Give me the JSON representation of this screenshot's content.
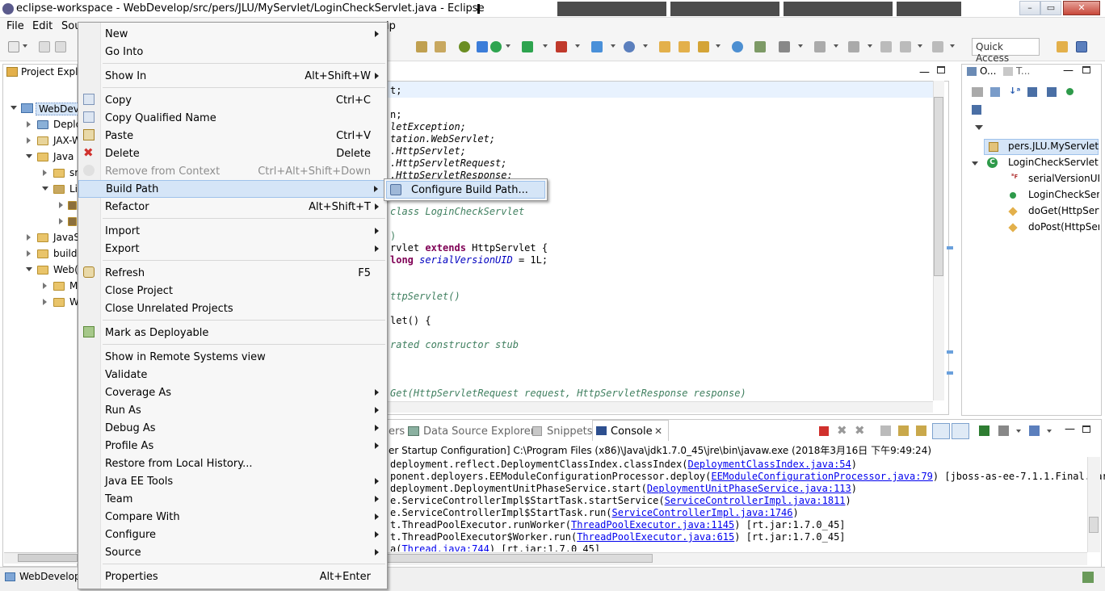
{
  "window": {
    "title": "eclipse-workspace - WebDevelop/src/pers/JLU/MyServlet/LoginCheckServlet.java - Eclipse",
    "minimize": "–",
    "maximize": "▭",
    "close": "✕"
  },
  "menubar": {
    "items": [
      "File",
      "Edit",
      "Sou",
      "lp"
    ]
  },
  "toolbar": {
    "quick_access": "Quick Access"
  },
  "project_explorer": {
    "tab_label": "Project Expl",
    "items": [
      {
        "label": "WebDevel"
      },
      {
        "label": "Deplo"
      },
      {
        "label": "JAX-W"
      },
      {
        "label": "Java"
      },
      {
        "label": "sr"
      },
      {
        "label": "Li"
      },
      {
        "label": "JavaS"
      },
      {
        "label": "build"
      },
      {
        "label": "Web("
      },
      {
        "label": "M"
      },
      {
        "label": "W"
      }
    ]
  },
  "context_menu": {
    "items": [
      {
        "label": "New",
        "accel": "",
        "submenu": true
      },
      {
        "label": "Go Into",
        "accel": ""
      },
      {
        "label": "Show In",
        "accel": "Alt+Shift+W",
        "submenu": true
      },
      {
        "label": "Copy",
        "accel": "Ctrl+C"
      },
      {
        "label": "Copy Qualified Name",
        "accel": ""
      },
      {
        "label": "Paste",
        "accel": "Ctrl+V"
      },
      {
        "label": "Delete",
        "accel": "Delete"
      },
      {
        "label": "Remove from Context",
        "accel": "Ctrl+Alt+Shift+Down"
      },
      {
        "label": "Build Path",
        "accel": "",
        "submenu": true
      },
      {
        "label": "Refactor",
        "accel": "Alt+Shift+T",
        "submenu": true
      },
      {
        "label": "Import",
        "accel": "",
        "submenu": true
      },
      {
        "label": "Export",
        "accel": "",
        "submenu": true
      },
      {
        "label": "Refresh",
        "accel": "F5"
      },
      {
        "label": "Close Project",
        "accel": ""
      },
      {
        "label": "Close Unrelated Projects",
        "accel": ""
      },
      {
        "label": "Mark as Deployable",
        "accel": ""
      },
      {
        "label": "Show in Remote Systems view",
        "accel": ""
      },
      {
        "label": "Validate",
        "accel": ""
      },
      {
        "label": "Coverage As",
        "accel": "",
        "submenu": true
      },
      {
        "label": "Run As",
        "accel": "",
        "submenu": true
      },
      {
        "label": "Debug As",
        "accel": "",
        "submenu": true
      },
      {
        "label": "Profile As",
        "accel": "",
        "submenu": true
      },
      {
        "label": "Restore from Local History...",
        "accel": ""
      },
      {
        "label": "Java EE Tools",
        "accel": "",
        "submenu": true
      },
      {
        "label": "Team",
        "accel": "",
        "submenu": true
      },
      {
        "label": "Compare With",
        "accel": "",
        "submenu": true
      },
      {
        "label": "Configure",
        "accel": "",
        "submenu": true
      },
      {
        "label": "Source",
        "accel": "",
        "submenu": true
      },
      {
        "label": "Properties",
        "accel": "Alt+Enter"
      }
    ]
  },
  "submenu": {
    "item": "Configure Build Path..."
  },
  "editor": {
    "lines": [
      {
        "text": "t;"
      },
      {
        "text": "n;"
      },
      {
        "text": "letException;"
      },
      {
        "text": "tation.WebServlet;"
      },
      {
        "text": ".HttpServlet;"
      },
      {
        "text": ".HttpServletRequest;"
      },
      {
        "text": ".HttpServletResponse;"
      },
      {
        "text": "class LoginCheckServlet"
      },
      {
        "text": ")"
      },
      {
        "text": "rvlet "
      },
      {
        "text": "extends"
      },
      {
        "text": " HttpServlet {"
      },
      {
        "text": "long"
      },
      {
        "text": " serialVersionUID"
      },
      {
        "text": " = 1L;"
      },
      {
        "text": "ttpServlet()"
      },
      {
        "text": "let() {"
      },
      {
        "text": "rated constructor stub"
      },
      {
        "text": "Get(HttpServletRequest request, HttpServletResponse response)"
      }
    ]
  },
  "outline": {
    "tab1": "O...",
    "tab2": "T...",
    "items": [
      "pers.JLU.MyServlet",
      "LoginCheckServlet",
      "serialVersionUI",
      "LoginCheckServ",
      "doGet(HttpServ",
      "doPost(HttpSer"
    ]
  },
  "bottom_tabs": {
    "servers": "ers",
    "data_source": "Data Source Explorer",
    "snippets": "Snippets",
    "console": "Console"
  },
  "console": {
    "header": "er Startup Configuration] C:\\Program Files (x86)\\Java\\jdk1.7.0_45\\jre\\bin\\javaw.exe (2018年3月16日 下午9:49:24)",
    "lines": [
      {
        "pre": "deployment.reflect.DeploymentClassIndex.classIndex(",
        "link": "DeploymentClassIndex.java:54",
        "post": ")"
      },
      {
        "pre": "ponent.deployers.EEModuleConfigurationProcessor.deploy(",
        "link": "EEModuleConfigurationProcessor.java:79",
        "post": ") [jboss-as-ee-7.1.1.Final.jar:"
      },
      {
        "pre": "deployment.DeploymentUnitPhaseService.start(",
        "link": "DeploymentUnitPhaseService.java:113",
        "post": ")"
      },
      {
        "pre": "e.ServiceControllerImpl$StartTask.startService(",
        "link": "ServiceControllerImpl.java:1811",
        "post": ")"
      },
      {
        "pre": "e.ServiceControllerImpl$StartTask.run(",
        "link": "ServiceControllerImpl.java:1746",
        "post": ")"
      },
      {
        "pre": "t.ThreadPoolExecutor.runWorker(",
        "link": "ThreadPoolExecutor.java:1145",
        "post": ") [rt.jar:1.7.0_45]"
      },
      {
        "pre": "t.ThreadPoolExecutor$Worker.run(",
        "link": "ThreadPoolExecutor.java:615",
        "post": ") [rt.jar:1.7.0_45]"
      },
      {
        "pre": "a(",
        "link": "Thread.java:744",
        "post": ") [rt.jar:1.7.0_45]"
      }
    ]
  },
  "statusbar": {
    "selected": "WebDevelop"
  }
}
